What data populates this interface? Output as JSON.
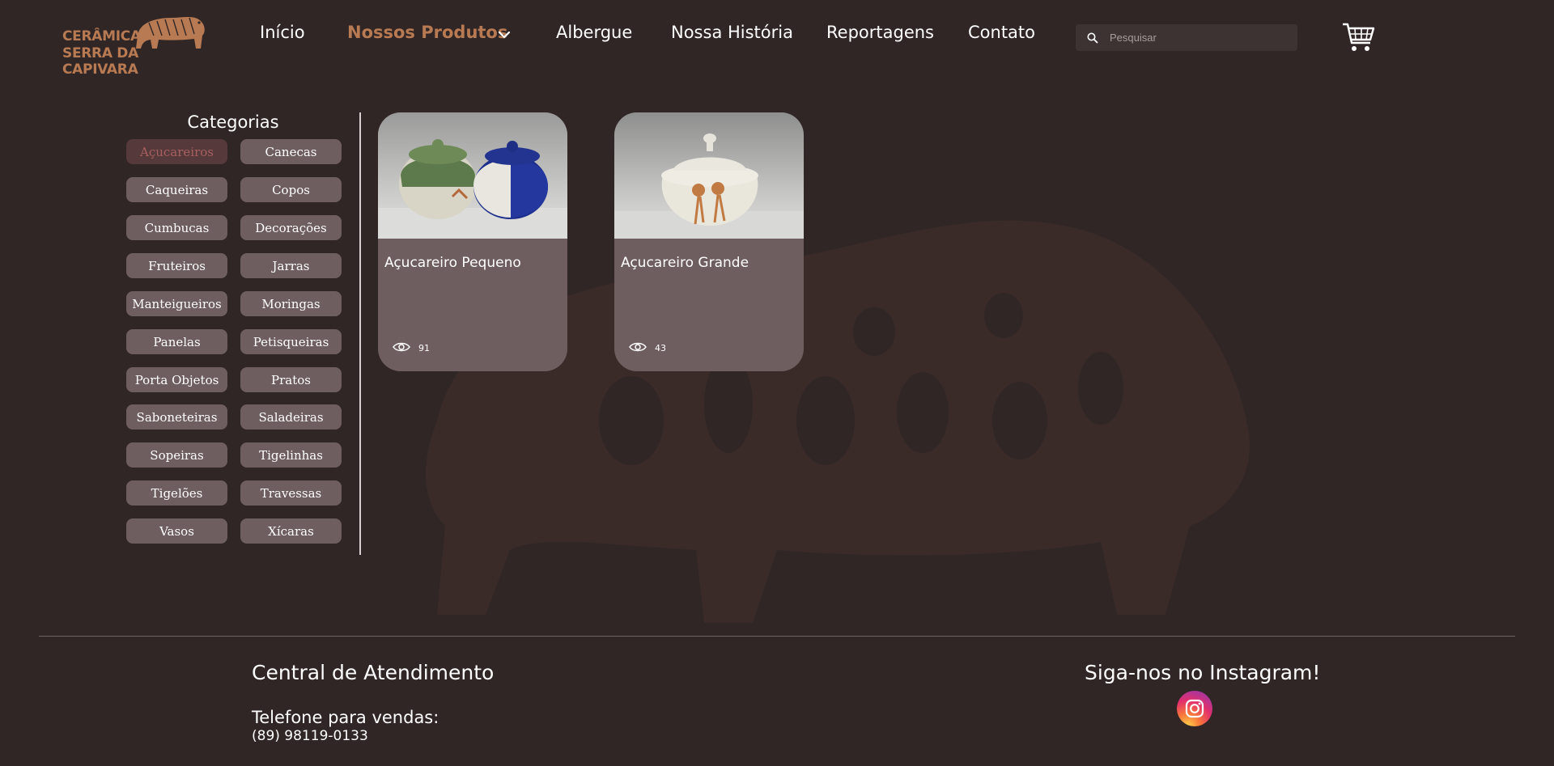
{
  "header": {
    "logo_line1": "CERÂMICA",
    "logo_line2": "SERRA DA CAPIVARA",
    "nav": [
      {
        "label": "Início",
        "active": false
      },
      {
        "label": "Nossos Produtos",
        "active": true
      },
      {
        "label": "Albergue",
        "active": false
      },
      {
        "label": "Nossa História",
        "active": false
      },
      {
        "label": "Reportagens",
        "active": false
      },
      {
        "label": "Contato",
        "active": false
      }
    ],
    "search_placeholder": "Pesquisar",
    "search_value": "",
    "icons": {
      "search": "search-icon",
      "cart": "cart-icon",
      "dropdown": "chevron-down-icon"
    }
  },
  "categories": {
    "title": "Categorias",
    "selected": "Açucareiros",
    "items": [
      "Açucareiros",
      "Canecas",
      "Caqueiras",
      "Copos",
      "Cumbucas",
      "Decorações",
      "Fruteiros",
      "Jarras",
      "Manteigueiros",
      "Moringas",
      "Panelas",
      "Petisqueiras",
      "Porta Objetos",
      "Pratos",
      "Saboneteiras",
      "Saladeiras",
      "Sopeiras",
      "Tigelinhas",
      "Tigelões",
      "Travessas",
      "Vasos",
      "Xícaras"
    ]
  },
  "products": [
    {
      "name": "Açucareiro Pequeno",
      "views": "91",
      "image": "two-sugar-bowls-green-blue"
    },
    {
      "name": "Açucareiro Grande",
      "views": "43",
      "image": "white-sugar-bowl-with-capybara-painting"
    }
  ],
  "footer": {
    "service_title": "Central de Atendimento",
    "sales_phone_label": "Telefone para vendas:",
    "sales_phone": "(89) 98119-0133",
    "instagram_title": "Siga-nos no Instagram!",
    "instagram_icon": "instagram-icon"
  },
  "colors": {
    "background": "#312626",
    "accent": "#b87a52",
    "card": "#6f5e5f",
    "selected_category": "#56393b"
  }
}
